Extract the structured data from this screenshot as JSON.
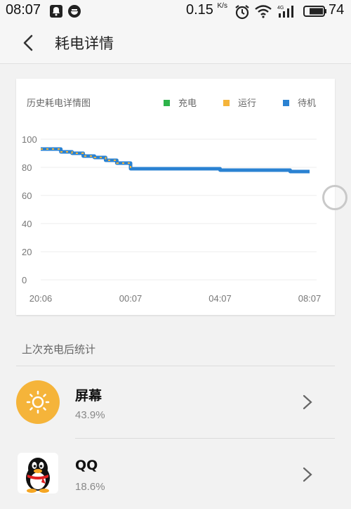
{
  "status_bar": {
    "time": "08:07",
    "net_speed": "0.15",
    "net_unit": "K/s",
    "battery_level": "74"
  },
  "header": {
    "title": "耗电详情"
  },
  "chart": {
    "title": "历史耗电详情图",
    "legend": [
      {
        "label": "充电",
        "color": "#2db34a"
      },
      {
        "label": "运行",
        "color": "#f5b43a"
      },
      {
        "label": "待机",
        "color": "#2a82d2"
      }
    ]
  },
  "chart_data": {
    "type": "line",
    "x_tick_labels": [
      "20:06",
      "00:07",
      "04:07",
      "08:07"
    ],
    "y_tick_labels": [
      "0",
      "20",
      "40",
      "60",
      "80",
      "100"
    ],
    "ylim": [
      0,
      100
    ],
    "series": [
      {
        "name": "待机",
        "x": [
          "20:06",
          "20:30",
          "21:00",
          "21:30",
          "22:00",
          "22:30",
          "23:00",
          "23:30",
          "00:07",
          "02:00",
          "04:07",
          "06:00",
          "07:15",
          "08:07"
        ],
        "y": [
          93,
          93,
          91,
          90,
          88,
          87,
          85,
          83,
          79,
          79,
          78,
          78,
          77,
          77
        ]
      }
    ],
    "grid": true
  },
  "section": {
    "label": "上次充电后统计"
  },
  "usage_items": [
    {
      "name": "屏幕",
      "percent": "43.9%",
      "icon": "sun-icon"
    },
    {
      "name": "QQ",
      "percent": "18.6%",
      "icon": "qq-penguin-icon"
    }
  ]
}
